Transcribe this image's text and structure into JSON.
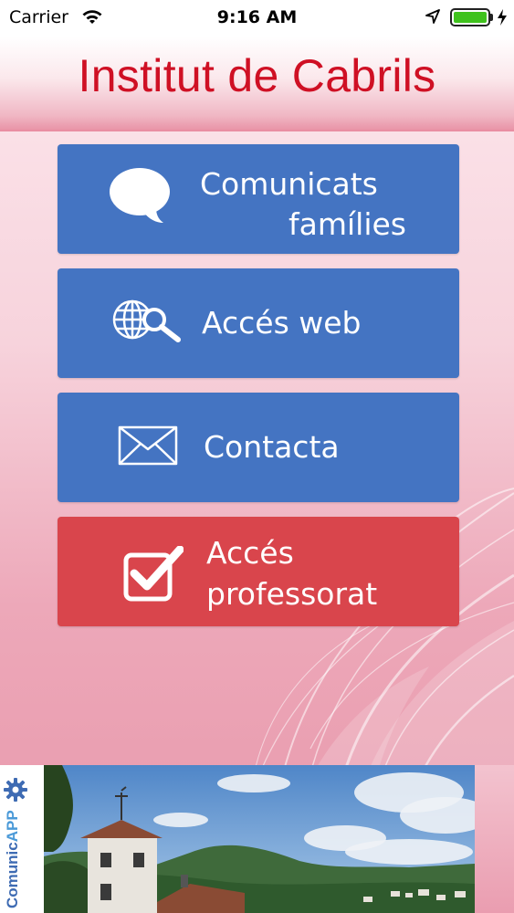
{
  "status_bar": {
    "carrier": "Carrier",
    "time": "9:16 AM"
  },
  "header": {
    "title": "Institut de Cabrils"
  },
  "menu": {
    "items": [
      {
        "line1": "Comunicats",
        "line2": "famílies",
        "icon": "chat-bubble-icon",
        "color": "#4474c2"
      },
      {
        "line1": "Accés web",
        "icon": "globe-search-icon",
        "color": "#4474c2"
      },
      {
        "line1": "Contacta",
        "icon": "envelope-icon",
        "color": "#4474c2"
      },
      {
        "line1": "Accés",
        "line2": "professorat",
        "icon": "checkbox-icon",
        "color": "#d9454c"
      }
    ]
  },
  "footer": {
    "brand_part1": "Comunic",
    "brand_part2": "APP",
    "brand_icon": "gear-icon",
    "photo": "landscape-photo"
  }
}
